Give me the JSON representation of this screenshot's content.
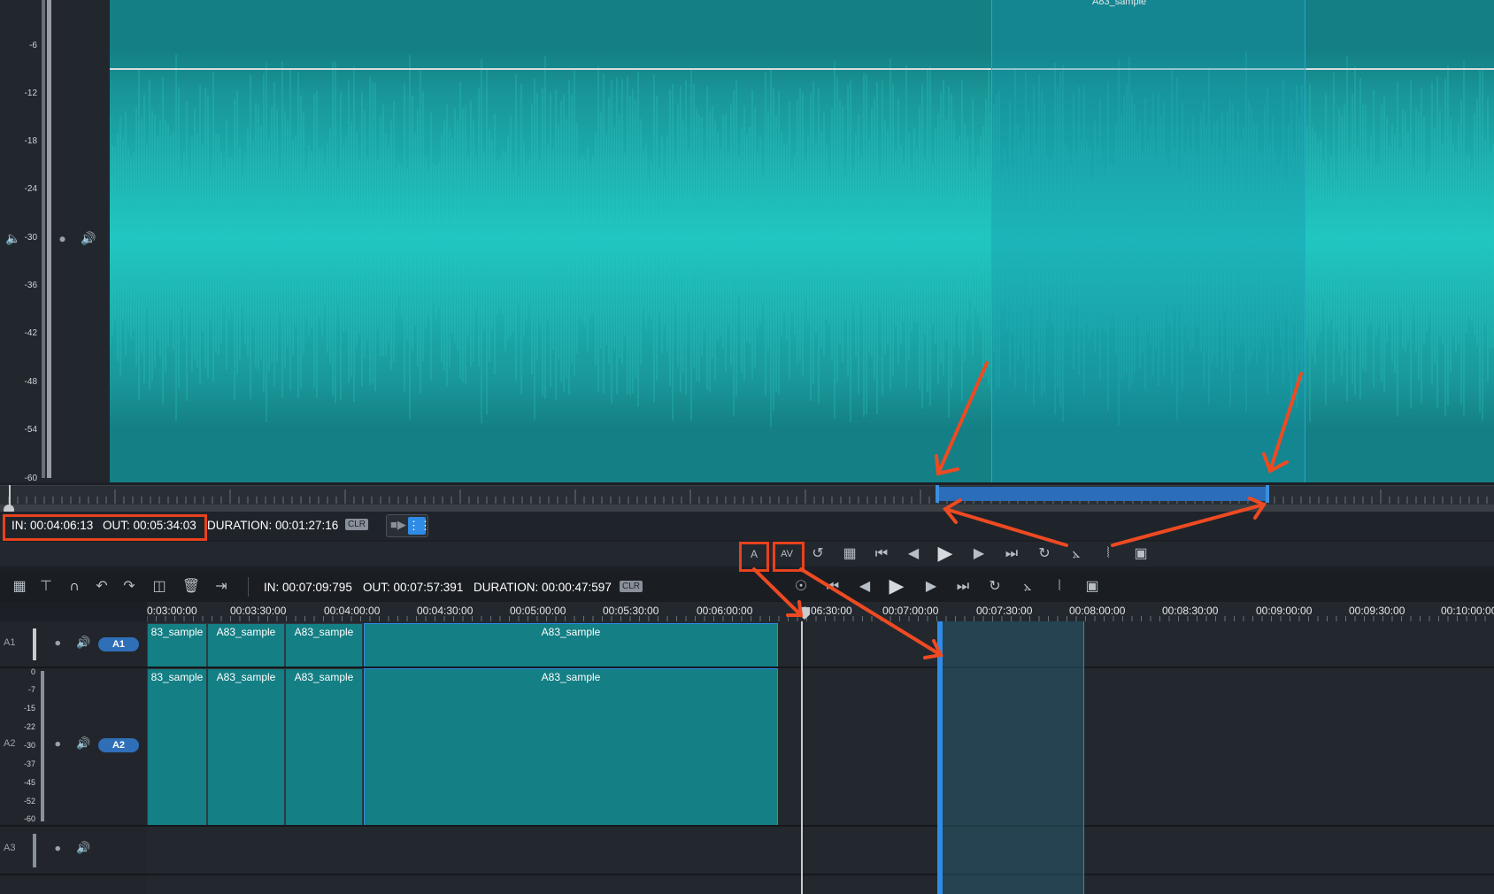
{
  "viewer": {
    "clip_name": "A83_sample",
    "db_scale": [
      "-6",
      "-12",
      "-18",
      "-24",
      "-30",
      "-36",
      "-42",
      "-48",
      "-54",
      "-60"
    ],
    "in_label": "IN: 00:04:06:13",
    "out_label": "OUT: 00:05:34:03",
    "duration_label": "DURATION: 00:01:27:16",
    "clr_label": "CLR",
    "video_toggle_icon": "video-camera-icon",
    "audio_toggle_icon": "audio-waveform-icon"
  },
  "viewer_tools": {
    "audio_only_label": "A",
    "av_label": "AV"
  },
  "timeline_toolbar": {
    "in_label": "IN: 00:07:09:795",
    "out_label": "OUT: 00:07:57:391",
    "duration_label": "DURATION: 00:00:47:597",
    "clr_label": "CLR"
  },
  "timeline_ruler": [
    "0:03:00:00",
    "00:03:30:00",
    "00:04:00:00",
    "00:04:30:00",
    "00:05:00:00",
    "00:05:30:00",
    "00:06:00:00",
    "0:06:30:00",
    "00:07:00:00",
    "00:07:30:00",
    "00:08:00:00",
    "00:08:30:00",
    "00:09:00:00",
    "00:09:30:00",
    "00:10:00:00"
  ],
  "tracks": [
    {
      "name": "A1",
      "pill": "A1",
      "clips": [
        "83_sample",
        "A83_sample",
        "A83_sample",
        "A83_sample"
      ]
    },
    {
      "name": "A2",
      "pill": "A2",
      "clips": [
        "83_sample",
        "A83_sample",
        "A83_sample",
        "A83_sample"
      ],
      "db_scale": [
        "0",
        "-7",
        "-15",
        "-22",
        "-30",
        "-37",
        "-45",
        "-52",
        "-60"
      ]
    },
    {
      "name": "A3"
    }
  ],
  "colors": {
    "accent": "#2f6fb8",
    "annotation": "#e8421d",
    "waveform": "#1fcfc8",
    "clip_bg": "#147f84"
  }
}
